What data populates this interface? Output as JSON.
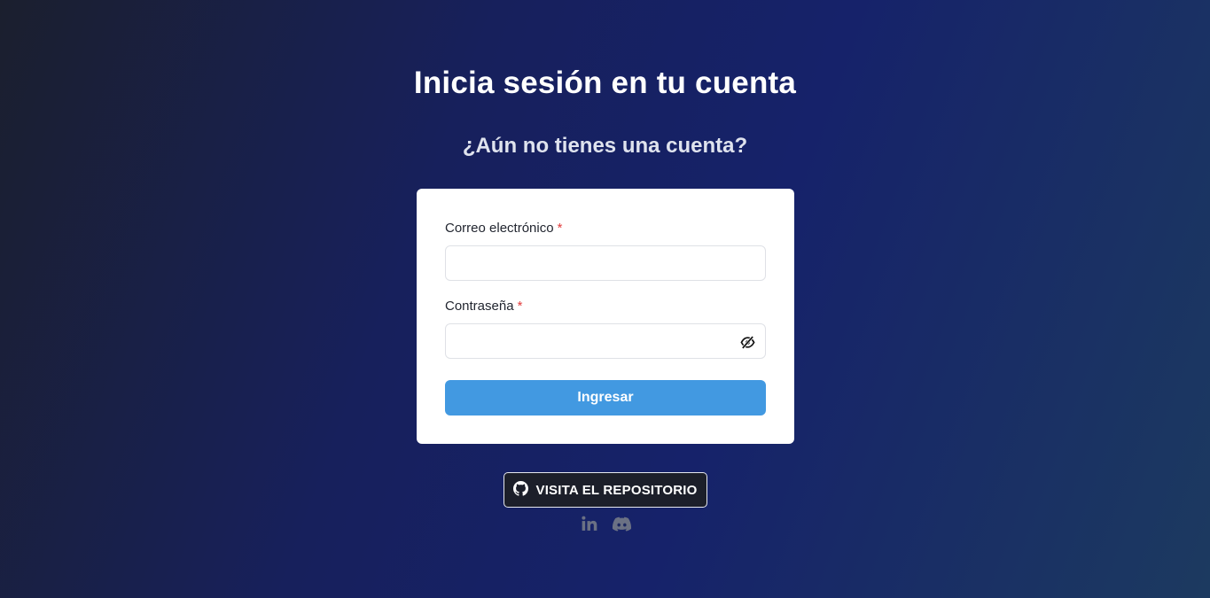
{
  "header": {
    "title": "Inicia sesión en tu cuenta",
    "subtitle": "¿Aún no tienes una cuenta?"
  },
  "form": {
    "email": {
      "label": "Correo electrónico",
      "required_mark": "*",
      "value": "",
      "placeholder": ""
    },
    "password": {
      "label": "Contraseña",
      "required_mark": "*",
      "value": "",
      "placeholder": "",
      "visibility_icon": "eye-slash-icon"
    },
    "submit_label": "Ingresar"
  },
  "footer": {
    "repo_label": "VISITA EL REPOSITORIO",
    "repo_icon": "github-icon",
    "social": [
      "linkedin-icon",
      "discord-icon"
    ]
  },
  "colors": {
    "accent": "#4299e1",
    "required": "#e23c3c",
    "card": "#ffffff"
  }
}
